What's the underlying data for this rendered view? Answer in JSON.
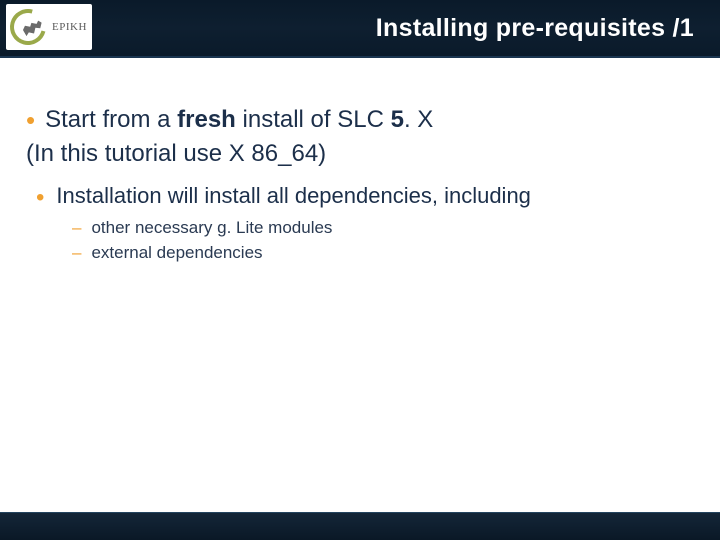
{
  "logo": {
    "text": "EPIKH"
  },
  "title": "Installing pre-requisites /1",
  "content": {
    "b1_pre": "Start from a ",
    "b1_bold1": "fresh",
    "b1_mid": " install of SLC ",
    "b1_bold2": "5",
    "b1_post": ". X",
    "paren": "(In this tutorial  use X 86_64)",
    "b2": "Installation will install all dependencies, including",
    "sub1": "other necessary g. Lite modules",
    "sub2": "external dependencies"
  }
}
